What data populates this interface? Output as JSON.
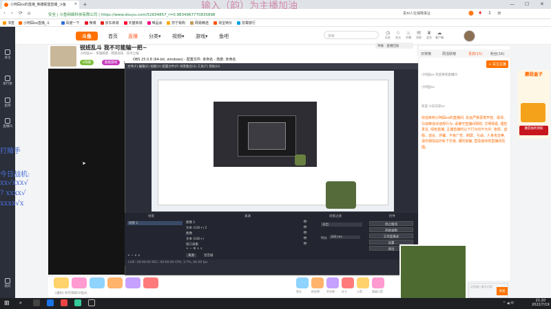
{
  "browser": {
    "tab_title": "小阿囧xx的直播_英雄联盟直播_斗鱼",
    "tab_close": "×",
    "new_tab": "+",
    "url_prefix": "安全 | 斗鱼网络科技有限公司 |",
    "url": "https://www.douyu.com/52834857_r=0.9834967770835898",
    "search_hint": "贵州人社保障事业",
    "win_min": "—",
    "win_max": "☐",
    "win_close": "✕"
  },
  "overlay_title": "输入（韵）为主播加油",
  "bookmarks": [
    {
      "label": "书签",
      "color": "#ff9a00"
    },
    {
      "label": "小阿囧xx直播_斗",
      "color": "#ff6a00"
    },
    {
      "label": "百度一下",
      "color": "#2f6fd8"
    },
    {
      "label": "微博",
      "color": "#e6162d"
    },
    {
      "label": "京东商城",
      "color": "#e1251b"
    },
    {
      "label": "天猫商城",
      "color": "#ff0036"
    },
    {
      "label": "唯品会",
      "color": "#f10180"
    },
    {
      "label": "苏宁易购",
      "color": "#ffaa00"
    },
    {
      "label": "网易精选",
      "color": "#c29a5b"
    },
    {
      "label": "淘宝特价",
      "color": "#ff5000"
    },
    {
      "label": "抗霉旅行",
      "color": "#00a0e9"
    }
  ],
  "sidebar": [
    {
      "label": "关注"
    },
    {
      "label": "排行榜"
    },
    {
      "label": "鱼吧"
    },
    {
      "label": "直播间"
    },
    {
      "label": "我的"
    }
  ],
  "header": {
    "logo": "斗鱼",
    "nav": [
      "首页",
      "直播",
      "分类▾",
      "视频▾",
      "游戏▾",
      "鱼吧"
    ],
    "search_placeholder": "搜索",
    "icons": [
      {
        "glyph": "◷",
        "label": "历史"
      },
      {
        "glyph": "☆",
        "label": "关注"
      },
      {
        "glyph": "♨",
        "label": "开播"
      },
      {
        "glyph": "✉",
        "label": "消息"
      },
      {
        "glyph": "♛",
        "label": "会员"
      },
      {
        "glyph": "☁",
        "label": "客户端"
      }
    ]
  },
  "stream": {
    "title": "锐班乱斗 我不可能输一把~",
    "meta": "小阿囧xx · 英雄联盟 · 网游竞技 · 热点之娱",
    "tags": [
      {
        "label": "V等级",
        "color": "#7fbf3f"
      },
      {
        "label": "超能游戏",
        "color": "#c63dbd"
      },
      {
        "label": "超级陪玩",
        "color": "#888888"
      }
    ],
    "report_label": "举报 · 直播回放"
  },
  "obs": {
    "title": "OBS 25.0.8 (64-bit, windows) - 配置文件: 未命名 - 场景: 未命名",
    "menu": "文件(F)   编辑(E)   视图(V)   配置文件(P)   场景集合(S)   工具(T)   帮助(H)",
    "docks": {
      "scenes_header": "场景",
      "sources_header": "来源",
      "mixer_header": "混音器",
      "transitions_header": "场景过渡",
      "controls_header": "控件",
      "scene_item": "场景 2",
      "sources": [
        "图像 2",
        "文本 (GDI+) 2",
        "图像",
        "文本 (GDI+)",
        "窗口采集"
      ],
      "transition": "淡出",
      "duration_label": "时长",
      "duration_value": "300 ms",
      "tab_sources": "来源",
      "tab_mixer": "混音器"
    },
    "controls": [
      "停止推流",
      "开始录制",
      "工作室模式",
      "设置",
      "退出"
    ],
    "status": "LIVE: 00:00:00   REC: 00:00:00   CPU: 3.7%, 60.00 fps"
  },
  "danmu": [
    "打赌手",
    "今日战机:",
    "xx√xxx√",
    "?  xxxx√",
    "xxxx√x"
  ],
  "right_panel": {
    "tabs": [
      "日常榜",
      "周活跃榜",
      "贵宾(15)",
      "粉丝(16)"
    ],
    "follow_label": "+ 关注主播",
    "chat_lines": [
      "小阿囧xx 欢迎来到直播间",
      "小阿囧xx",
      "欢迎 小白兄弟xx"
    ],
    "notice": "欢迎来到小阿囧xx的直播间, 永远严禁恶意开挂、辱骂、引战等违法违规行为, 请遵守直播间规则, 文明观看, 理性发言, 绿色直播, 主播直播时以下行为均不允许: 违规、虚假、谣言、诈骗、不良广告、刷屏、引战、人身攻击等, 请勿相信站外私下交易, 谨防受骗, 营造良好的直播间氛围。",
    "chat_placeholder": "这里输入聊天内容",
    "send_label": "发送"
  },
  "promo": {
    "title": "蘑菇盒子",
    "button": "蘑菇福利领取",
    "badge": "新"
  },
  "gifts": [
    "鱼丸",
    "粉丝牌",
    "荧光棒",
    "办卡",
    "火箭",
    "超级火箭"
  ],
  "gift_bar_text": "[通知] 你可领取10鱼丸",
  "taskbar": {
    "time": "21:20",
    "date": "2022/7/19",
    "tray": "^  ◀  中"
  }
}
